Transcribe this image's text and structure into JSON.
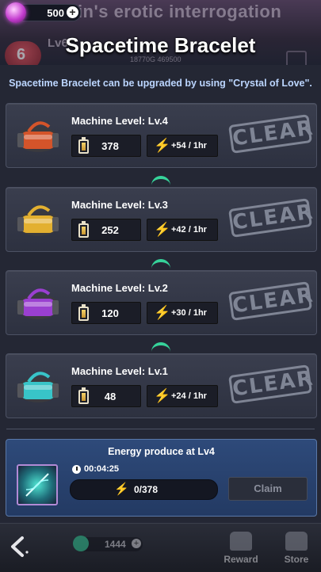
{
  "background": {
    "title_text": "oin's erotic interrogation",
    "level_text": "Lv6",
    "heart_value": "6",
    "number_text": "18770G 469500"
  },
  "header": {
    "currency_amount": "500",
    "title": "Spacetime Bracelet",
    "subtitle": "Spacetime Bracelet can be upgraded by using \"Crystal of Love\"."
  },
  "machines": [
    {
      "label": "Machine Level: Lv.4",
      "energy": "378",
      "rate": "+54 / 1hr",
      "status": "CLEAR",
      "color": "#d4542a"
    },
    {
      "label": "Machine Level: Lv.3",
      "energy": "252",
      "rate": "+42 / 1hr",
      "status": "CLEAR",
      "color": "#e3b030"
    },
    {
      "label": "Machine Level: Lv.2",
      "energy": "120",
      "rate": "+30 / 1hr",
      "status": "CLEAR",
      "color": "#9a3fd0"
    },
    {
      "label": "Machine Level: Lv.1",
      "energy": "48",
      "rate": "+24 / 1hr",
      "status": "CLEAR",
      "color": "#38c4c8"
    }
  ],
  "energy_panel": {
    "title": "Energy produce at Lv4",
    "timer": "00:04:25",
    "progress_text": "0/378",
    "progress_fraction": 0,
    "claim_label": "Claim"
  },
  "bottom_bar": {
    "gem_amount": "1444",
    "reward_label": "Reward",
    "store_label": "Store"
  },
  "colors": {
    "accent_green": "#39e6a6",
    "bolt": "#f2c233",
    "subtitle": "#bcd6ff"
  }
}
